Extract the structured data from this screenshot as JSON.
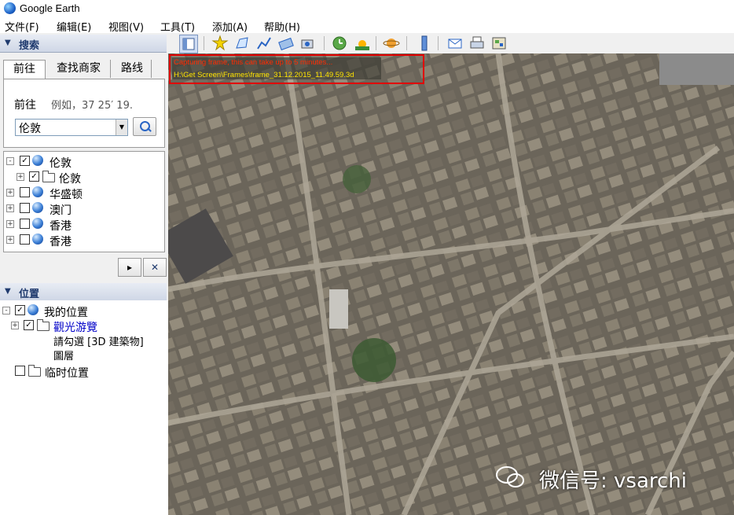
{
  "window": {
    "title": "Google Earth"
  },
  "menu": [
    "文件(F)",
    "编辑(E)",
    "视图(V)",
    "工具(T)",
    "添加(A)",
    "帮助(H)"
  ],
  "search_panel": {
    "header": "搜索",
    "tabs": [
      "前往",
      "查找商家",
      "路线"
    ],
    "go_label": "前往",
    "hint": "例如，37 25′ 19.",
    "input_value": "伦敦",
    "results": [
      {
        "label": "伦敦",
        "checked": true,
        "type": "globe",
        "expander": "-"
      },
      {
        "label": "伦敦",
        "checked": true,
        "type": "folder",
        "expander": "+"
      },
      {
        "label": "华盛顿",
        "checked": false,
        "type": "globe",
        "expander": "+"
      },
      {
        "label": "澳门",
        "checked": false,
        "type": "globe",
        "expander": "+"
      },
      {
        "label": "香港",
        "checked": false,
        "type": "globe",
        "expander": "+"
      },
      {
        "label": "香港",
        "checked": false,
        "type": "globe",
        "expander": "+"
      }
    ]
  },
  "places_panel": {
    "header": "位置",
    "my_places": "我的位置",
    "sightseeing": "觀光游覽",
    "sightseeing_note_1": "請勾選 [3D 建築物]",
    "sightseeing_note_2": "圖層",
    "temp_places": "临时位置"
  },
  "status": {
    "line1": "Capturing frame, this can take up to 5 minutes...",
    "line2": "H:\\Get Screen\\Frames\\frame_31.12.2015_11.49.59.3d"
  },
  "watermark": "微信号: vsarchi",
  "colors": {
    "status_border": "#e00000",
    "status_line1": "#ff2a00",
    "status_line2": "#ffe400",
    "accent": "#1f3a6e"
  }
}
